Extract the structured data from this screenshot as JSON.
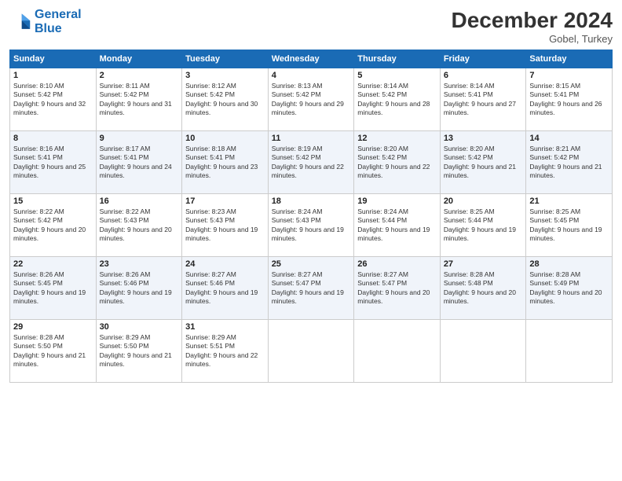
{
  "header": {
    "logo_line1": "General",
    "logo_line2": "Blue",
    "month_title": "December 2024",
    "location": "Gobel, Turkey"
  },
  "days_of_week": [
    "Sunday",
    "Monday",
    "Tuesday",
    "Wednesday",
    "Thursday",
    "Friday",
    "Saturday"
  ],
  "weeks": [
    [
      {
        "day": "1",
        "sunrise": "8:10 AM",
        "sunset": "5:42 PM",
        "daylight": "9 hours and 32 minutes."
      },
      {
        "day": "2",
        "sunrise": "8:11 AM",
        "sunset": "5:42 PM",
        "daylight": "9 hours and 31 minutes."
      },
      {
        "day": "3",
        "sunrise": "8:12 AM",
        "sunset": "5:42 PM",
        "daylight": "9 hours and 30 minutes."
      },
      {
        "day": "4",
        "sunrise": "8:13 AM",
        "sunset": "5:42 PM",
        "daylight": "9 hours and 29 minutes."
      },
      {
        "day": "5",
        "sunrise": "8:14 AM",
        "sunset": "5:42 PM",
        "daylight": "9 hours and 28 minutes."
      },
      {
        "day": "6",
        "sunrise": "8:14 AM",
        "sunset": "5:41 PM",
        "daylight": "9 hours and 27 minutes."
      },
      {
        "day": "7",
        "sunrise": "8:15 AM",
        "sunset": "5:41 PM",
        "daylight": "9 hours and 26 minutes."
      }
    ],
    [
      {
        "day": "8",
        "sunrise": "8:16 AM",
        "sunset": "5:41 PM",
        "daylight": "9 hours and 25 minutes."
      },
      {
        "day": "9",
        "sunrise": "8:17 AM",
        "sunset": "5:41 PM",
        "daylight": "9 hours and 24 minutes."
      },
      {
        "day": "10",
        "sunrise": "8:18 AM",
        "sunset": "5:41 PM",
        "daylight": "9 hours and 23 minutes."
      },
      {
        "day": "11",
        "sunrise": "8:19 AM",
        "sunset": "5:42 PM",
        "daylight": "9 hours and 22 minutes."
      },
      {
        "day": "12",
        "sunrise": "8:20 AM",
        "sunset": "5:42 PM",
        "daylight": "9 hours and 22 minutes."
      },
      {
        "day": "13",
        "sunrise": "8:20 AM",
        "sunset": "5:42 PM",
        "daylight": "9 hours and 21 minutes."
      },
      {
        "day": "14",
        "sunrise": "8:21 AM",
        "sunset": "5:42 PM",
        "daylight": "9 hours and 21 minutes."
      }
    ],
    [
      {
        "day": "15",
        "sunrise": "8:22 AM",
        "sunset": "5:42 PM",
        "daylight": "9 hours and 20 minutes."
      },
      {
        "day": "16",
        "sunrise": "8:22 AM",
        "sunset": "5:43 PM",
        "daylight": "9 hours and 20 minutes."
      },
      {
        "day": "17",
        "sunrise": "8:23 AM",
        "sunset": "5:43 PM",
        "daylight": "9 hours and 19 minutes."
      },
      {
        "day": "18",
        "sunrise": "8:24 AM",
        "sunset": "5:43 PM",
        "daylight": "9 hours and 19 minutes."
      },
      {
        "day": "19",
        "sunrise": "8:24 AM",
        "sunset": "5:44 PM",
        "daylight": "9 hours and 19 minutes."
      },
      {
        "day": "20",
        "sunrise": "8:25 AM",
        "sunset": "5:44 PM",
        "daylight": "9 hours and 19 minutes."
      },
      {
        "day": "21",
        "sunrise": "8:25 AM",
        "sunset": "5:45 PM",
        "daylight": "9 hours and 19 minutes."
      }
    ],
    [
      {
        "day": "22",
        "sunrise": "8:26 AM",
        "sunset": "5:45 PM",
        "daylight": "9 hours and 19 minutes."
      },
      {
        "day": "23",
        "sunrise": "8:26 AM",
        "sunset": "5:46 PM",
        "daylight": "9 hours and 19 minutes."
      },
      {
        "day": "24",
        "sunrise": "8:27 AM",
        "sunset": "5:46 PM",
        "daylight": "9 hours and 19 minutes."
      },
      {
        "day": "25",
        "sunrise": "8:27 AM",
        "sunset": "5:47 PM",
        "daylight": "9 hours and 19 minutes."
      },
      {
        "day": "26",
        "sunrise": "8:27 AM",
        "sunset": "5:47 PM",
        "daylight": "9 hours and 20 minutes."
      },
      {
        "day": "27",
        "sunrise": "8:28 AM",
        "sunset": "5:48 PM",
        "daylight": "9 hours and 20 minutes."
      },
      {
        "day": "28",
        "sunrise": "8:28 AM",
        "sunset": "5:49 PM",
        "daylight": "9 hours and 20 minutes."
      }
    ],
    [
      {
        "day": "29",
        "sunrise": "8:28 AM",
        "sunset": "5:50 PM",
        "daylight": "9 hours and 21 minutes."
      },
      {
        "day": "30",
        "sunrise": "8:29 AM",
        "sunset": "5:50 PM",
        "daylight": "9 hours and 21 minutes."
      },
      {
        "day": "31",
        "sunrise": "8:29 AM",
        "sunset": "5:51 PM",
        "daylight": "9 hours and 22 minutes."
      },
      null,
      null,
      null,
      null
    ]
  ]
}
